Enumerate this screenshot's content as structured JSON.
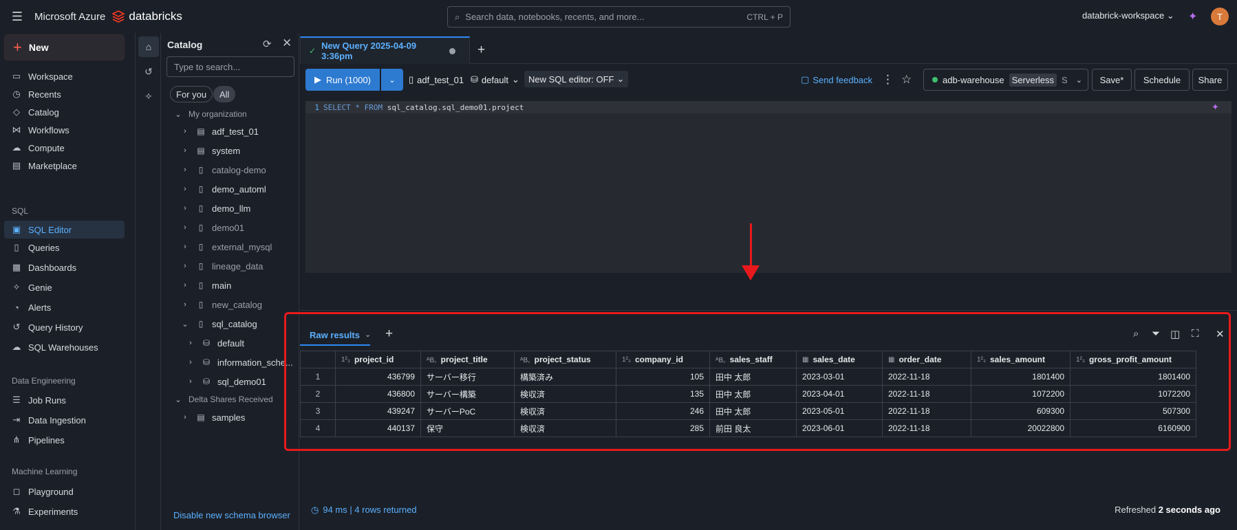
{
  "topbar": {
    "brand": "Microsoft Azure",
    "product": "databricks",
    "search_placeholder": "Search data, notebooks, recents, and more...",
    "search_shortcut": "CTRL + P",
    "workspace": "databrick-workspace",
    "avatar_initial": "T"
  },
  "sidebar": {
    "new_label": "New",
    "items": [
      {
        "label": "Workspace",
        "icon": "folder-icon"
      },
      {
        "label": "Recents",
        "icon": "clock-icon"
      },
      {
        "label": "Catalog",
        "icon": "catalog-icon"
      },
      {
        "label": "Workflows",
        "icon": "workflows-icon"
      },
      {
        "label": "Compute",
        "icon": "cloud-icon"
      },
      {
        "label": "Marketplace",
        "icon": "store-icon"
      }
    ],
    "sql_section": "SQL",
    "sql_items": [
      {
        "label": "SQL Editor",
        "icon": "sql-editor-icon",
        "active": true
      },
      {
        "label": "Queries",
        "icon": "queries-icon"
      },
      {
        "label": "Dashboards",
        "icon": "dashboard-icon"
      },
      {
        "label": "Genie",
        "icon": "genie-icon"
      },
      {
        "label": "Alerts",
        "icon": "bell-icon"
      },
      {
        "label": "Query History",
        "icon": "history-icon"
      },
      {
        "label": "SQL Warehouses",
        "icon": "warehouse-icon"
      }
    ],
    "de_section": "Data Engineering",
    "de_items": [
      {
        "label": "Job Runs",
        "icon": "job-runs-icon"
      },
      {
        "label": "Data Ingestion",
        "icon": "ingestion-icon"
      },
      {
        "label": "Pipelines",
        "icon": "pipelines-icon"
      }
    ],
    "ml_section": "Machine Learning",
    "ml_items": [
      {
        "label": "Playground",
        "icon": "playground-icon"
      },
      {
        "label": "Experiments",
        "icon": "experiments-icon"
      }
    ]
  },
  "catalog": {
    "title": "Catalog",
    "search_placeholder": "Type to search...",
    "filter_for_you": "For you",
    "filter_all": "All",
    "my_org": "My organization",
    "items": [
      {
        "label": "adf_test_01",
        "dim": false
      },
      {
        "label": "system",
        "dim": false
      },
      {
        "label": "catalog-demo",
        "dim": true
      },
      {
        "label": "demo_automl",
        "dim": false
      },
      {
        "label": "demo_llm",
        "dim": false
      },
      {
        "label": "demo01",
        "dim": true
      },
      {
        "label": "external_mysql",
        "dim": true
      },
      {
        "label": "lineage_data",
        "dim": true
      },
      {
        "label": "main",
        "dim": false
      },
      {
        "label": "new_catalog",
        "dim": true
      },
      {
        "label": "sql_catalog",
        "dim": false
      }
    ],
    "schemas": [
      "default",
      "information_sche...",
      "sql_demo01"
    ],
    "delta_shares": "Delta Shares Received",
    "samples": "samples",
    "disable_link": "Disable new schema browser"
  },
  "editor": {
    "tab_title": "New Query 2025-04-09 3:36pm",
    "run_label": "Run (1000)",
    "catalog_name": "adf_test_01",
    "schema_name": "default",
    "new_editor_toggle": "New SQL editor: OFF",
    "send_feedback": "Send feedback",
    "warehouse": "adb-warehouse",
    "warehouse_type": "Serverless",
    "warehouse_size": "S",
    "save_label": "Save*",
    "schedule_label": "Schedule",
    "share_label": "Share",
    "line_number": "1",
    "sql_kw1": "SELECT",
    "sql_star": "*",
    "sql_kw2": "FROM",
    "sql_table": "sql_catalog.sql_demo01.project"
  },
  "results": {
    "tab_label": "Raw results",
    "columns": [
      {
        "name": "project_id",
        "type": "123"
      },
      {
        "name": "project_title",
        "type": "ABC"
      },
      {
        "name": "project_status",
        "type": "ABC"
      },
      {
        "name": "company_id",
        "type": "123"
      },
      {
        "name": "sales_staff",
        "type": "ABC"
      },
      {
        "name": "sales_date",
        "type": "date"
      },
      {
        "name": "order_date",
        "type": "date"
      },
      {
        "name": "sales_amount",
        "type": "123"
      },
      {
        "name": "gross_profit_amount",
        "type": "123"
      }
    ],
    "rows": [
      [
        "1",
        "436799",
        "サーバー移行",
        "構築済み",
        "105",
        "田中 太郎",
        "2023-03-01",
        "2022-11-18",
        "1801400",
        "1801400"
      ],
      [
        "2",
        "436800",
        "サーバー構築",
        "検収済",
        "135",
        "田中 太郎",
        "2023-04-01",
        "2022-11-18",
        "1072200",
        "1072200"
      ],
      [
        "3",
        "439247",
        "サーバーPoC",
        "検収済",
        "246",
        "田中 太郎",
        "2023-05-01",
        "2022-11-18",
        "609300",
        "507300"
      ],
      [
        "4",
        "440137",
        "保守",
        "検収済",
        "285",
        "前田 良太",
        "2023-06-01",
        "2022-11-18",
        "20022800",
        "6160900"
      ]
    ],
    "status": "94 ms | 4 rows returned",
    "refreshed_prefix": "Refreshed",
    "refreshed_time": "2 seconds ago"
  },
  "colors": {
    "accent": "#2f8af5",
    "annotation_red": "#e8191c",
    "status_green": "#3fbf6e"
  }
}
